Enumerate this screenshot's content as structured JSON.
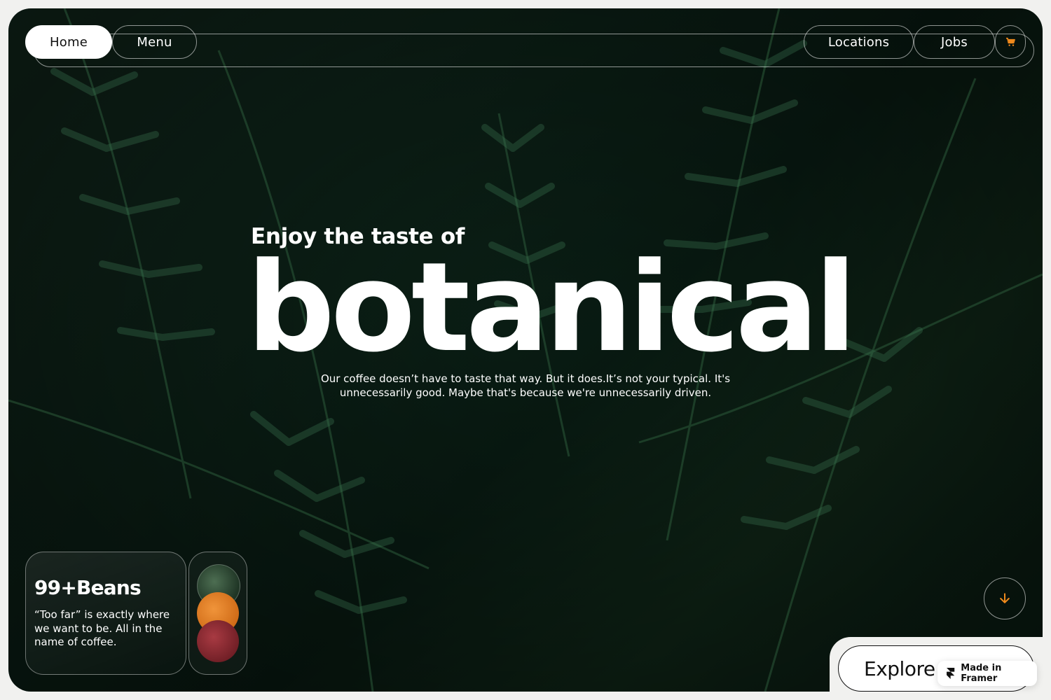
{
  "nav": {
    "home_label": "Home",
    "menu_label": "Menu",
    "locations_label": "Locations",
    "jobs_label": "Jobs",
    "cart_icon": "cart-icon"
  },
  "hero": {
    "eyebrow": "Enjoy the taste of",
    "headline": "botanical",
    "description": "Our coffee doesn’t have to taste that way. But it does.It’s not your typical. It's unnecessarily good. Maybe that's because we're unnecessarily driven."
  },
  "beans_card": {
    "title": "99+Beans",
    "text": "“Too far” is exactly where we want to be. All in the name of coffee."
  },
  "swatches": [
    {
      "name": "leaf-green",
      "color": "#2f4a34"
    },
    {
      "name": "orange-beans",
      "color": "#e07a23"
    },
    {
      "name": "red-beans",
      "color": "#8a2a30"
    }
  ],
  "scroll_button": {
    "icon": "arrow-down-icon",
    "color": "#f08a1c"
  },
  "explore_button": {
    "label": "Explore Our Menu"
  },
  "framer_badge": {
    "label": "Made in Framer",
    "icon": "framer-logo-icon"
  },
  "colors": {
    "accent": "#f08a1c",
    "background": "#0f2a1d",
    "text": "#ffffff"
  }
}
